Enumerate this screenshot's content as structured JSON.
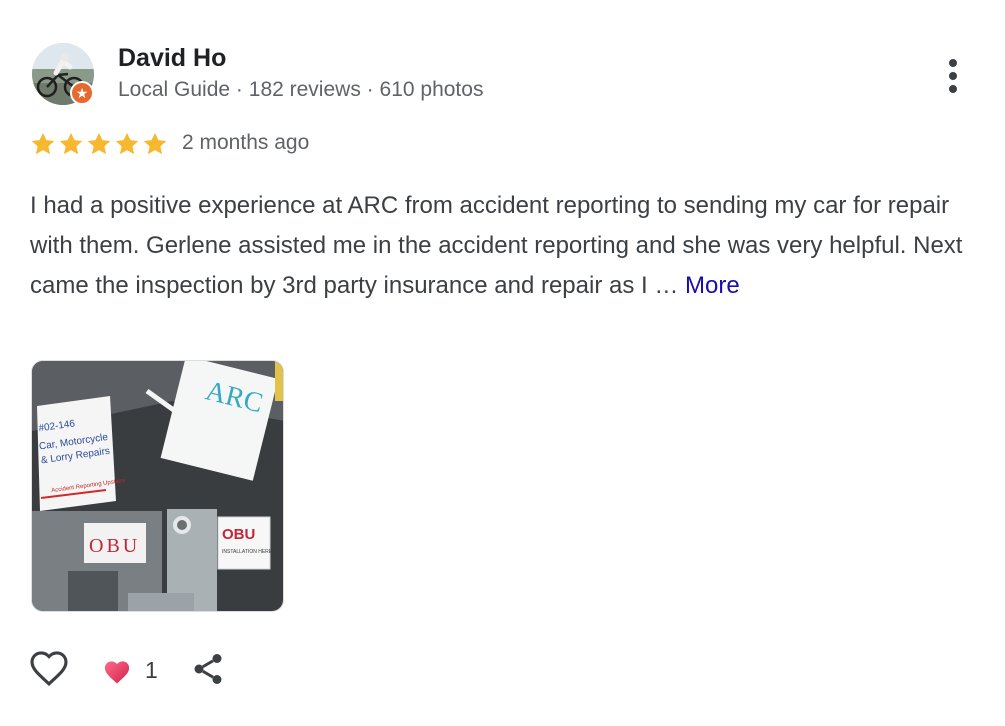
{
  "reviewer": {
    "name": "David Ho",
    "badge": "Local Guide",
    "reviews": "182 reviews",
    "photos": "610 photos",
    "separator": "·"
  },
  "review": {
    "rating": 5,
    "time": "2 months ago",
    "text": "I had a positive experience at ARC from accident reporting to sending my car for repair with them. Gerlene assisted me in the accident reporting and she was very helpful. Next came the inspection by 3rd party insurance and repair as I …",
    "more_label": "More"
  },
  "photo": {
    "sign_main": "ARC",
    "sign_unit": "#02-146",
    "sign_line1": "Car, Motorcycle",
    "sign_line2": "& Lorry Repairs",
    "sign_arrow": "Accident Reporting Upstairs",
    "obu_left": "OBU",
    "obu_right": "OBU",
    "obu_sub": "INSTALLATION HERE"
  },
  "actions": {
    "reaction_count": "1"
  },
  "colors": {
    "star": "#f5b82e",
    "link": "#1a0dab",
    "badge": "#e8692e"
  }
}
